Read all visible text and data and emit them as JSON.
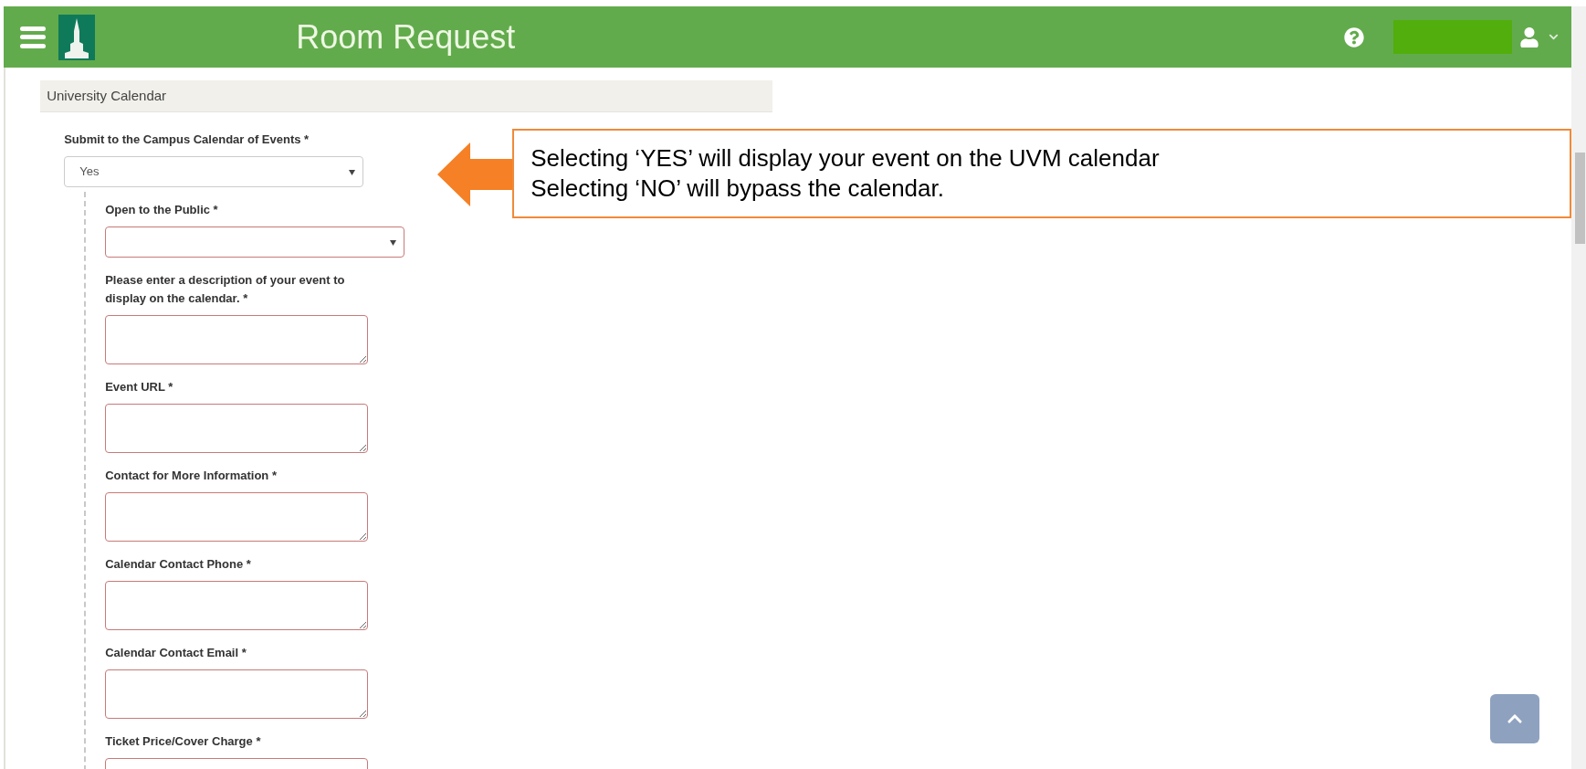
{
  "header": {
    "title": "Room Request"
  },
  "section": {
    "title": "University Calendar"
  },
  "main_field": {
    "label": "Submit to the Campus Calendar of Events *",
    "kind": "select",
    "value": "Yes",
    "invalid": false
  },
  "fields": [
    {
      "label": "Open to the Public *",
      "kind": "select",
      "invalid": true
    },
    {
      "label": "Please enter a description of your event to display on the calendar. *",
      "kind": "textarea",
      "invalid": true
    },
    {
      "label": "Event URL *",
      "kind": "textarea",
      "invalid": true
    },
    {
      "label": "Contact for More Information *",
      "kind": "textarea",
      "invalid": true
    },
    {
      "label": "Calendar Contact Phone *",
      "kind": "textarea",
      "invalid": true
    },
    {
      "label": "Calendar Contact Email *",
      "kind": "textarea",
      "invalid": true
    },
    {
      "label": "Ticket Price/Cover Charge *",
      "kind": "textarea",
      "invalid": true
    }
  ],
  "callout": {
    "lines": [
      "Selecting ‘YES’ will display your event on the UVM calendar",
      "Selecting ‘NO’ will bypass the calendar."
    ]
  }
}
